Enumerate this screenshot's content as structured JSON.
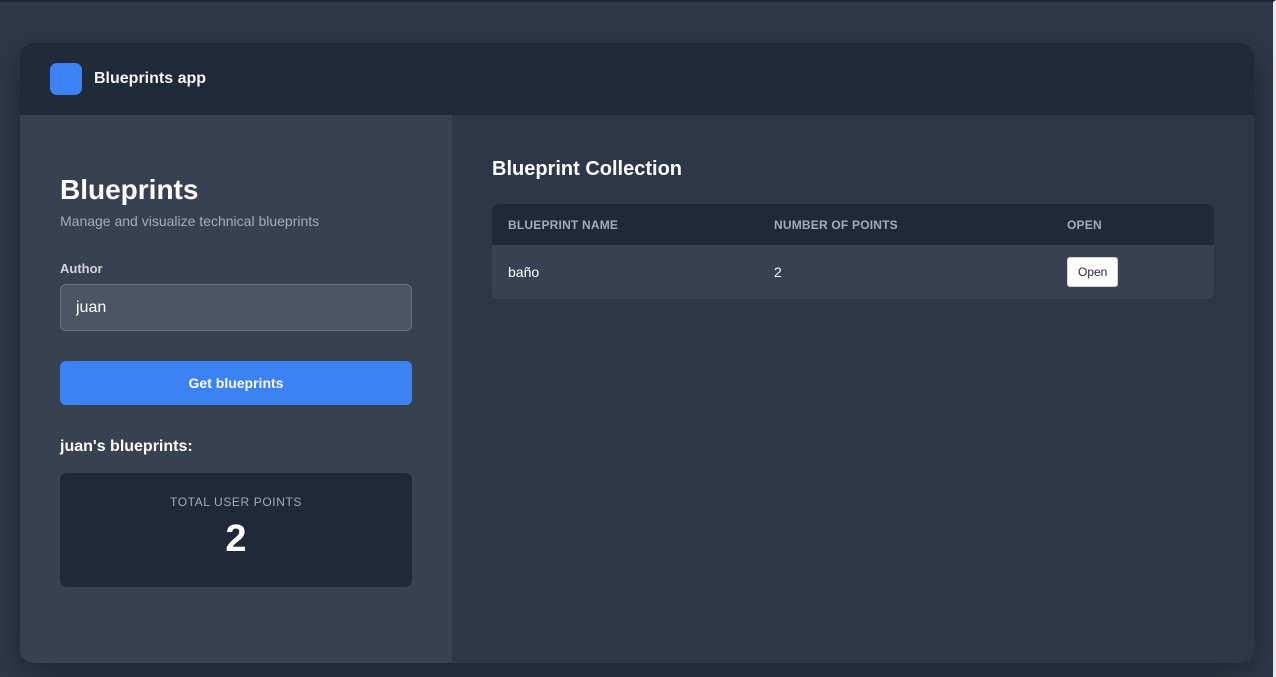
{
  "header": {
    "app_title": "Blueprints app",
    "logo_color": "#3b82f6"
  },
  "sidebar": {
    "title": "Blueprints",
    "subtitle": "Manage and visualize technical blueprints",
    "author_label": "Author",
    "author_value": "juan",
    "get_button_label": "Get blueprints",
    "section_heading": "juan's blueprints:",
    "stats": {
      "label": "TOTAL USER POINTS",
      "value": "2"
    }
  },
  "main": {
    "title": "Blueprint Collection",
    "table": {
      "headers": [
        "BLUEPRINT NAME",
        "NUMBER OF POINTS",
        "OPEN"
      ],
      "rows": [
        {
          "name": "baño",
          "points": "2",
          "action": "Open"
        }
      ]
    }
  },
  "colors": {
    "accent": "#3b82f6",
    "panel": "#374151",
    "header": "#1f2937",
    "background": "#2d3748"
  }
}
